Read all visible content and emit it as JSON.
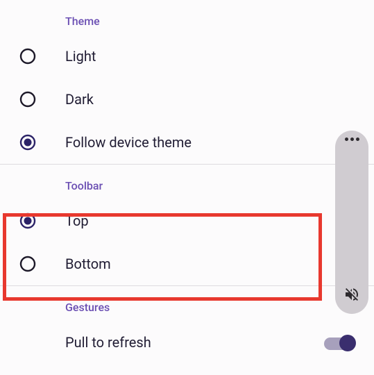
{
  "colors": {
    "accent": "#6b4fb3",
    "highlight": "#e8382e",
    "radio_selected": "#2b2267"
  },
  "theme": {
    "header": "Theme",
    "options": [
      {
        "label": "Light",
        "selected": false
      },
      {
        "label": "Dark",
        "selected": false
      },
      {
        "label": "Follow device theme",
        "selected": true
      }
    ]
  },
  "toolbar": {
    "header": "Toolbar",
    "options": [
      {
        "label": "Top",
        "selected": true
      },
      {
        "label": "Bottom",
        "selected": false
      }
    ]
  },
  "gestures": {
    "header": "Gestures",
    "items": [
      {
        "label": "Pull to refresh",
        "enabled": true
      }
    ]
  },
  "scroll_handle": {
    "icon": "volume-mute-icon"
  },
  "highlight": {
    "target": "toolbar-section"
  }
}
